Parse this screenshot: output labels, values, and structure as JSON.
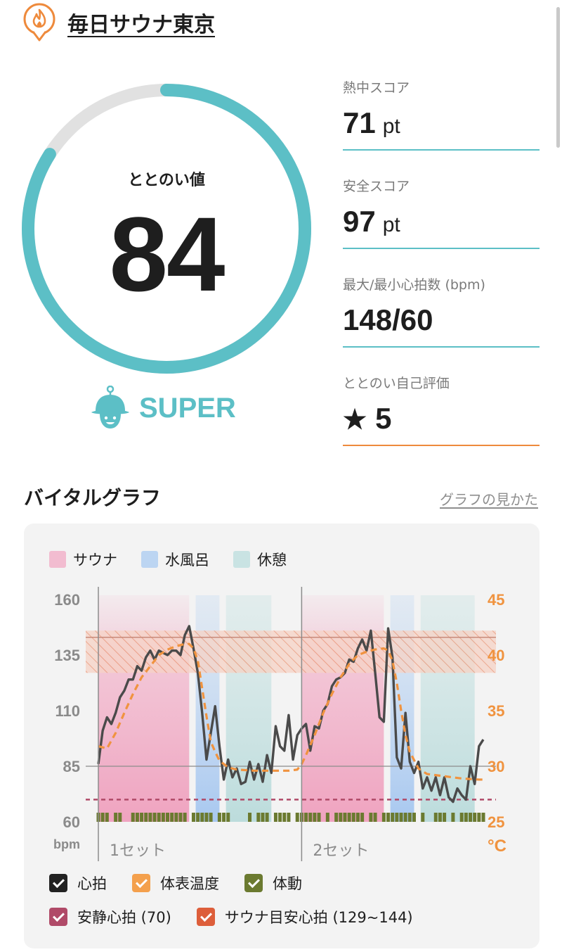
{
  "header": {
    "facility_name": "毎日サウナ東京"
  },
  "score": {
    "label": "ととのい値",
    "value": "84",
    "gauge_fraction": 0.84,
    "rank": "SUPER"
  },
  "stats": [
    {
      "label": "熱中スコア",
      "value": "71",
      "unit": "pt"
    },
    {
      "label": "安全スコア",
      "value": "97",
      "unit": "pt"
    },
    {
      "label": "最大/最小心拍数 (bpm)",
      "value": "148/60",
      "unit": ""
    },
    {
      "label": "ととのい自己評価",
      "value": "5",
      "unit": ""
    }
  ],
  "vital": {
    "title": "バイタルグラフ",
    "help_link": "グラフの見かた",
    "legend_top": [
      {
        "label": "サウナ",
        "color": "#f2bcd0"
      },
      {
        "label": "水風呂",
        "color": "#bcd5f2"
      },
      {
        "label": "休憩",
        "color": "#c9e3e3"
      }
    ],
    "legend_bottom": [
      {
        "label": "心拍",
        "color": "#222222"
      },
      {
        "label": "体表温度",
        "color": "#f4a04c"
      },
      {
        "label": "体動",
        "color": "#6b7a30"
      },
      {
        "label": "安静心拍 (70)",
        "color": "#b04a68"
      },
      {
        "label": "サウナ目安心拍 (129~144)",
        "color": "#dd5e3a"
      }
    ]
  },
  "chart_data": {
    "type": "line",
    "ylabel_left": "bpm",
    "ylabel_right": "°C",
    "yticks_left": [
      "160",
      "135",
      "110",
      "85",
      "60"
    ],
    "yticks_right": [
      "45",
      "40",
      "35",
      "30",
      "25"
    ],
    "ylim_left": [
      60,
      160
    ],
    "ylim_right": [
      25,
      45
    ],
    "set_labels": [
      "1セット",
      "2セット"
    ],
    "resting_hr": 70,
    "sauna_target": [
      129,
      144
    ],
    "phases": [
      {
        "type": "サウナ",
        "start": 0,
        "end": 21
      },
      {
        "type": "水風呂",
        "start": 22.5,
        "end": 28
      },
      {
        "type": "休憩",
        "start": 29.5,
        "end": 40
      },
      {
        "type": "サウナ",
        "start": 47,
        "end": 66
      },
      {
        "type": "水風呂",
        "start": 67.5,
        "end": 73
      },
      {
        "type": "休憩",
        "start": 74.5,
        "end": 87
      }
    ],
    "set_starts": [
      0,
      47
    ],
    "series": [
      {
        "name": "心拍",
        "x": [
          0,
          1,
          2,
          3,
          4,
          5,
          6,
          7,
          8,
          9,
          10,
          11,
          12,
          13,
          14,
          15,
          16,
          17,
          18,
          19,
          20,
          21,
          22,
          23,
          24,
          25,
          26,
          27,
          28,
          29,
          30,
          31,
          32,
          33,
          34,
          35,
          36,
          37,
          38,
          39,
          40,
          41,
          42,
          43,
          44,
          45,
          46,
          47,
          48,
          49,
          50,
          51,
          52,
          53,
          54,
          55,
          56,
          57,
          58,
          59,
          60,
          61,
          62,
          63,
          64,
          65,
          66,
          67,
          68,
          69,
          70,
          71,
          72,
          73,
          74,
          75,
          76,
          77,
          78,
          79,
          80,
          81,
          82,
          83,
          84,
          85,
          86,
          87,
          88,
          89
        ],
        "values": [
          86,
          101,
          107,
          104,
          109,
          116,
          119,
          124,
          124,
          130,
          128,
          134,
          137,
          133,
          137,
          136,
          135,
          137,
          137,
          135,
          144,
          148,
          138,
          127,
          109,
          88,
          100,
          112,
          94,
          79,
          88,
          80,
          84,
          77,
          78,
          87,
          79,
          86,
          78,
          90,
          82,
          103,
          94,
          92,
          108,
          88,
          99,
          102,
          104,
          92,
          103,
          102,
          110,
          113,
          121,
          124,
          125,
          127,
          133,
          132,
          138,
          142,
          137,
          146,
          127,
          107,
          105,
          147,
          134,
          89,
          84,
          109,
          87,
          82,
          87,
          75,
          80,
          74,
          80,
          72,
          80,
          71,
          69,
          75,
          72,
          70,
          85,
          77,
          94,
          97
        ]
      },
      {
        "name": "体表温度",
        "x": [
          0,
          2,
          4,
          6,
          8,
          10,
          12,
          14,
          16,
          18,
          20,
          21,
          22,
          23,
          24,
          25,
          26,
          27,
          28,
          30,
          32,
          36,
          40,
          44,
          46,
          47,
          48,
          50,
          52,
          54,
          56,
          58,
          60,
          62,
          64,
          66,
          67,
          68,
          69,
          70,
          71,
          72,
          74,
          76,
          80,
          84,
          88,
          89
        ],
        "values": [
          31.8,
          31.6,
          33,
          34.8,
          36.5,
          38,
          39,
          40,
          40.5,
          40.8,
          41,
          41,
          40.6,
          39.5,
          37,
          34.5,
          32.2,
          31.3,
          30.5,
          29.9,
          29.7,
          29.6,
          29.6,
          29.6,
          29.7,
          30.2,
          31,
          32.8,
          34.8,
          36.5,
          38,
          39.2,
          40,
          40.3,
          40.5,
          40.6,
          40.4,
          39.5,
          37.5,
          35,
          32.8,
          31.3,
          29.8,
          29.3,
          29.1,
          28.9,
          28.8,
          28.8
        ]
      }
    ],
    "body_motion_marks": [
      0,
      1,
      2,
      4,
      5,
      8,
      9,
      10,
      11,
      12,
      13,
      14,
      15,
      16,
      17,
      18,
      19,
      20,
      22,
      23,
      24,
      25,
      26,
      28,
      29,
      30,
      35,
      37,
      38,
      39,
      41,
      42,
      43,
      44,
      46,
      47,
      48,
      49,
      50,
      51,
      53,
      55,
      56,
      57,
      58,
      59,
      60,
      61,
      63,
      64,
      66,
      67,
      68,
      69,
      70,
      71,
      72,
      73,
      75,
      78,
      79,
      80,
      82,
      84,
      85,
      86,
      87,
      88,
      89
    ],
    "grid": true
  }
}
